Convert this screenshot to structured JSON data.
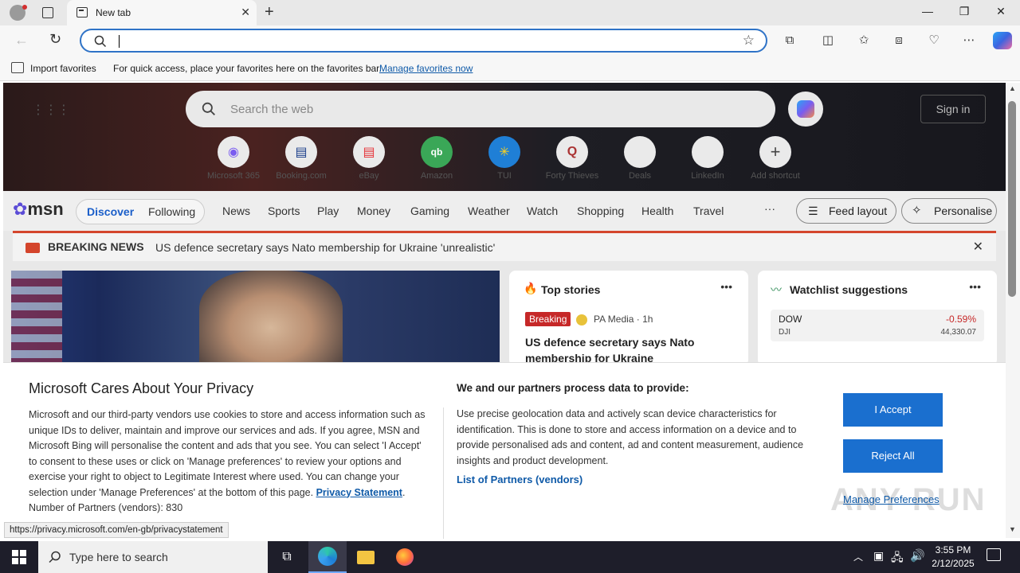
{
  "browser": {
    "tab_title": "New tab",
    "address_value": "",
    "favbar": {
      "import_label": "Import favorites",
      "message": "For quick access, place your favorites here on the favorites bar.",
      "manage_link": "Manage favorites now"
    }
  },
  "msn": {
    "search_placeholder": "Search the web",
    "signin_label": "Sign in",
    "shortcuts": [
      {
        "label": "Microsoft 365",
        "icon": "ms365-icon"
      },
      {
        "label": "Booking.com",
        "icon": "booking-icon"
      },
      {
        "label": "eBay",
        "icon": "ebay-icon"
      },
      {
        "label": "Amazon",
        "icon": "amazon-icon"
      },
      {
        "label": "TUI",
        "icon": "tui-icon"
      },
      {
        "label": "Forty Thieves",
        "icon": "forty-thieves-icon"
      },
      {
        "label": "Deals",
        "icon": "deals-icon"
      },
      {
        "label": "LinkedIn",
        "icon": "linkedin-icon"
      },
      {
        "label": "Add shortcut",
        "icon": "plus-icon"
      }
    ],
    "logo": "msn",
    "discover": "Discover",
    "following": "Following",
    "nav": [
      "News",
      "Sports",
      "Play",
      "Money",
      "Gaming",
      "Weather",
      "Watch",
      "Shopping",
      "Health",
      "Travel"
    ],
    "more": "···",
    "feed_layout": "Feed layout",
    "personalise": "Personalise",
    "breaking_label": "BREAKING NEWS",
    "breaking_text": "US defence secretary says Nato membership for Ukraine 'unrealistic'",
    "top_stories": {
      "title": "Top stories",
      "badge": "Breaking",
      "source": "PA Media · 1h",
      "headline": "US defence secretary says Nato membership for Ukraine 'unrealistic'"
    },
    "watchlist": {
      "title": "Watchlist suggestions",
      "symbol": "DOW",
      "sub": "DJI",
      "change": "-0.59%",
      "value": "44,330.07",
      "change_color": "#c62828"
    }
  },
  "privacy": {
    "title": "Microsoft Cares About Your Privacy",
    "body": "Microsoft and our third-party vendors use cookies to store and access information such as unique IDs to deliver, maintain and improve our services and ads. If you agree, MSN and Microsoft Bing will personalise the content and ads that you see. You can select 'I Accept' to consent to these uses or click on 'Manage preferences' to review your options and exercise your right to object to Legitimate Interest where used.  You can change your selection under 'Manage Preferences' at the bottom of this page.",
    "privacy_link": "Privacy Statement",
    "partners_count_label": "Number of Partners (vendors): 830",
    "right_title": "We and our partners process data to provide:",
    "right_body": "Use precise geolocation data and actively scan device characteristics for identification. This is done to store and access information on a device and to provide personalised ads and content, ad and content measurement, audience insights and product development.",
    "partners_link": "List of Partners (vendors)",
    "accept": "I Accept",
    "reject": "Reject All",
    "manage": "Manage Preferences"
  },
  "status_url": "https://privacy.microsoft.com/en-gb/privacystatement",
  "watermark": "ANY RUN",
  "taskbar": {
    "search_placeholder": "Type here to search",
    "time": "3:55 PM",
    "date": "2/12/2025"
  }
}
